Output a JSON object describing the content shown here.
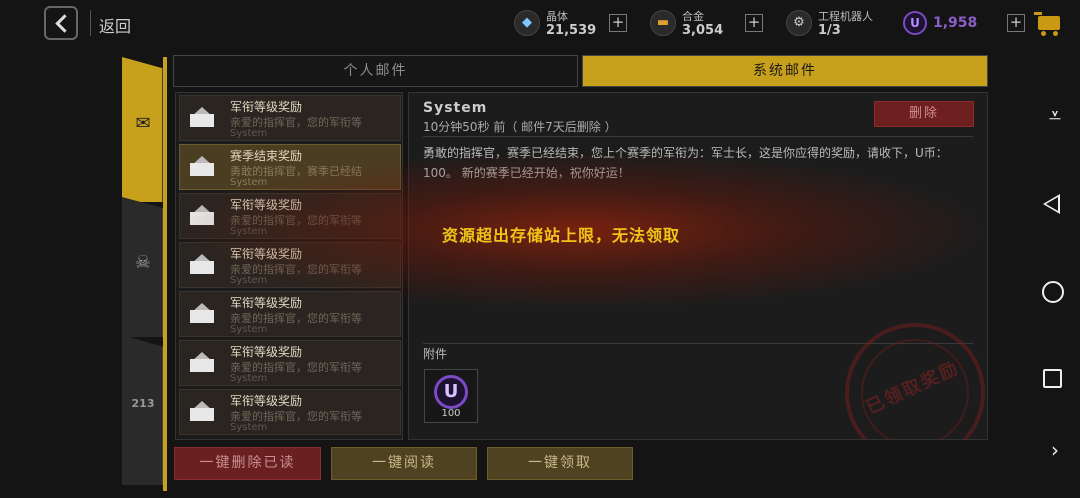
{
  "header": {
    "back_label": "返回",
    "resources": [
      {
        "name": "晶体",
        "value": "21,539",
        "icon": "crystal-icon"
      },
      {
        "name": "合金",
        "value": "3,054",
        "icon": "alloy-icon"
      },
      {
        "name": "工程机器人",
        "value": "1/3",
        "icon": "robot-icon"
      }
    ],
    "u_coin_symbol": "U",
    "u_coin_value": "1,958",
    "plus_symbol": "+"
  },
  "tabs": {
    "personal": "个人邮件",
    "system": "系统邮件"
  },
  "side_tabs": [
    {
      "icon": "mail-icon",
      "active": true
    },
    {
      "icon": "crossed-skull-icon",
      "active": false
    },
    {
      "icon": "ranking-podium-icon",
      "label": "213",
      "active": false
    }
  ],
  "mail_list": [
    {
      "title": "军衔等级奖励",
      "preview": "亲爱的指挥官，您的军衔等",
      "sender": "System",
      "selected": false
    },
    {
      "title": "赛季结束奖励",
      "preview": "勇敢的指挥官，赛季已经结",
      "sender": "System",
      "selected": true
    },
    {
      "title": "军衔等级奖励",
      "preview": "亲爱的指挥官，您的军衔等",
      "sender": "System",
      "selected": false
    },
    {
      "title": "军衔等级奖励",
      "preview": "亲爱的指挥官，您的军衔等",
      "sender": "System",
      "selected": false
    },
    {
      "title": "军衔等级奖励",
      "preview": "亲爱的指挥官，您的军衔等",
      "sender": "System",
      "selected": false
    },
    {
      "title": "军衔等级奖励",
      "preview": "亲爱的指挥官，您的军衔等",
      "sender": "System",
      "selected": false
    },
    {
      "title": "军衔等级奖励",
      "preview": "亲爱的指挥官，您的军衔等",
      "sender": "System",
      "selected": false
    }
  ],
  "detail": {
    "sender": "System",
    "time": "10分钟50秒 前（ 邮件7天后删除 ）",
    "delete_label": "删除",
    "body": "勇敢的指挥官，赛季已经结束，您上个赛季的军衔为：军士长，这是你应得的奖励，请收下，U币：100。 新的赛季已经开始，祝你好运！",
    "attachment_label": "附件",
    "attachment": {
      "symbol": "U",
      "quantity": "100"
    },
    "stamp_text": "已领取奖励"
  },
  "toast": "资源超出存储站上限，无法领取",
  "bottom_buttons": {
    "delete_read": "一键删除已读",
    "read_all": "一键阅读",
    "claim_all": "一键领取"
  },
  "colors": {
    "accent": "#c8a11c",
    "danger": "#6e1f20",
    "premium": "#7a4bc4",
    "toast": "#f0c419"
  }
}
